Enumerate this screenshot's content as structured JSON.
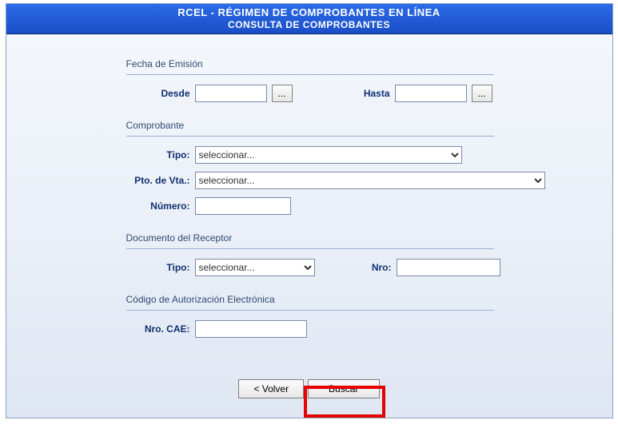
{
  "header": {
    "line1": "RCEL - RÉGIMEN DE COMPROBANTES EN LÍNEA",
    "line2": "CONSULTA DE COMPROBANTES"
  },
  "fecha_emision": {
    "title": "Fecha de Emisión",
    "desde_label": "Desde",
    "hasta_label": "Hasta",
    "picker_label": "..."
  },
  "comprobante": {
    "title": "Comprobante",
    "tipo_label": "Tipo:",
    "tipo_value": "seleccionar...",
    "pto_vta_label": "Pto. de Vta.:",
    "pto_vta_value": "seleccionar...",
    "numero_label": "Número:"
  },
  "receptor": {
    "title": "Documento del Receptor",
    "tipo_label": "Tipo:",
    "tipo_value": "seleccionar...",
    "nro_label": "Nro:"
  },
  "cae": {
    "title": "Código de Autorización Electrónica",
    "nro_label": "Nro. CAE:"
  },
  "actions": {
    "volver": "< Volver",
    "buscar": "Buscar"
  }
}
